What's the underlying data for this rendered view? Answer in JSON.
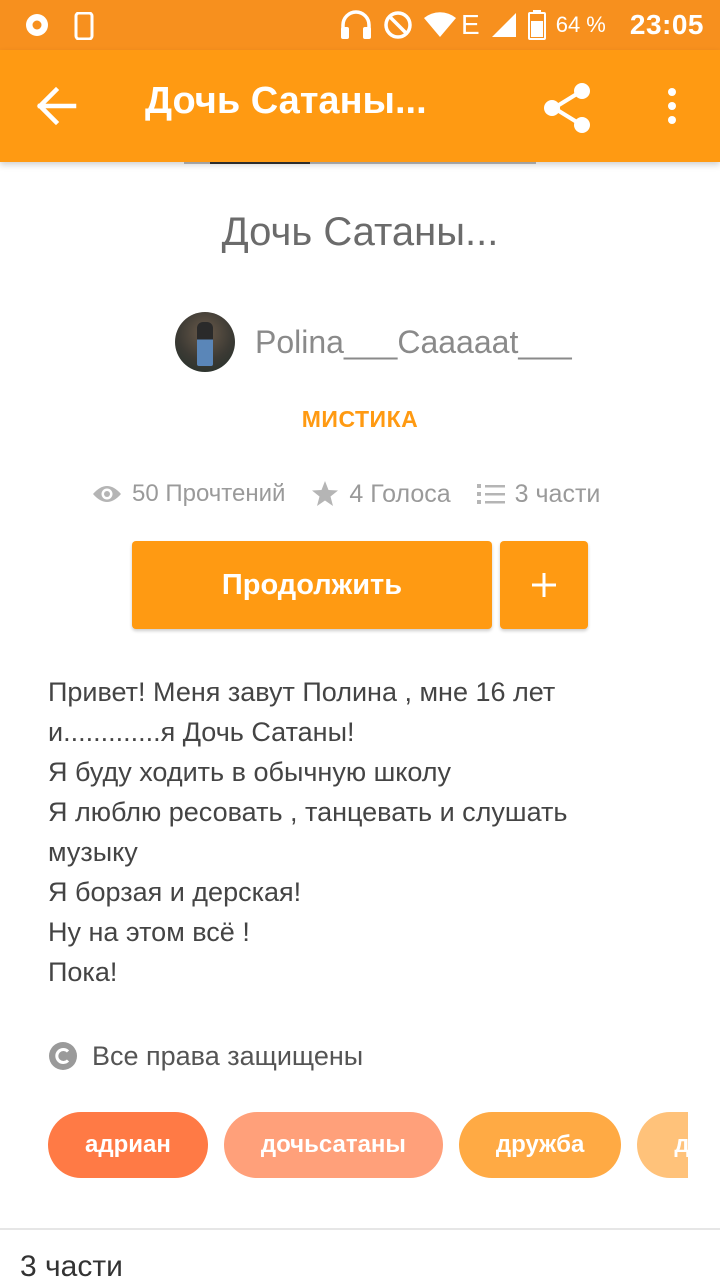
{
  "status_bar": {
    "battery_percent": "64 %",
    "time": "23:05",
    "network": "E"
  },
  "app_bar": {
    "title": "Дочь Сатаны..."
  },
  "story": {
    "title": "Дочь Сатаны...",
    "author": "Polina___Caaaaat___",
    "category": "МИСТИКА",
    "stats": {
      "reads": "50 Прочтений",
      "votes": "4 Голоса",
      "parts": "3 части"
    },
    "continue_label": "Продолжить",
    "add_label": "+",
    "description_lines": [
      "Привет! Меня завут Полина , мне 16 лет",
      "и.............я Дочь Сатаны!",
      "Я буду ходить в обычную школу",
      "Я люблю ресовать , танцевать и слушать",
      "музыку",
      "Я борзая и дерская!",
      "Ну на этом всё !",
      "Пока!"
    ],
    "rights": "Все права защищены",
    "tags": [
      {
        "label": "адриан",
        "color": "#ff7a45"
      },
      {
        "label": "дочьсатаны",
        "color": "#ffa07a"
      },
      {
        "label": "дружба",
        "color": "#ffaa44"
      },
      {
        "label": "дьявол",
        "color": "#ffc27a"
      }
    ],
    "parts_heading": "3 части"
  },
  "colors": {
    "accent": "#ff9a12",
    "status_bar": "#f7901e"
  }
}
